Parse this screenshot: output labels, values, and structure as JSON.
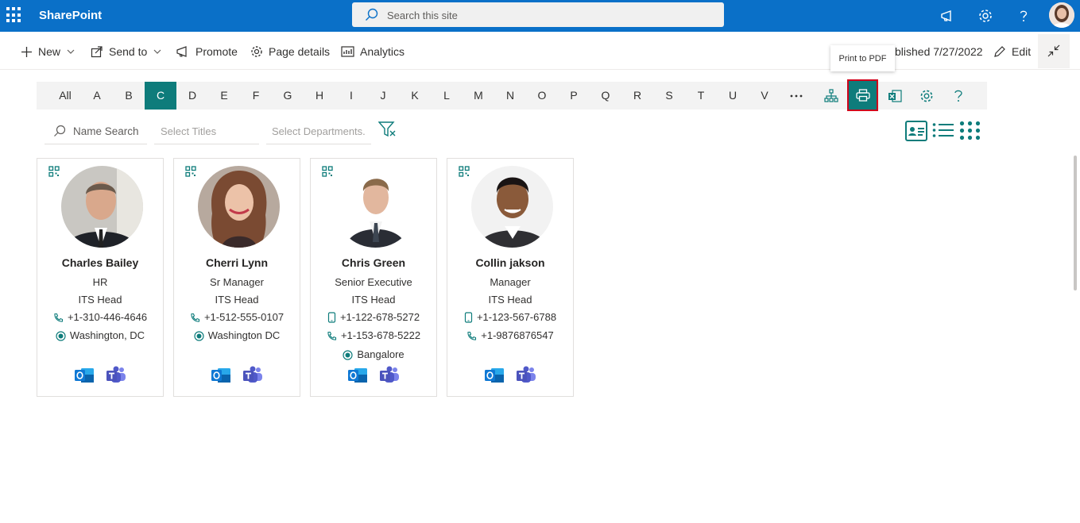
{
  "topbar": {
    "brand": "SharePoint",
    "search_placeholder": "Search this site"
  },
  "commandbar": {
    "new_label": "New",
    "send_to_label": "Send to",
    "promote_label": "Promote",
    "page_details_label": "Page details",
    "analytics_label": "Analytics",
    "published_text": "blished 7/27/2022",
    "edit_label": "Edit"
  },
  "tooltip": "Print to PDF",
  "alphabet": [
    "All",
    "A",
    "B",
    "C",
    "D",
    "E",
    "F",
    "G",
    "H",
    "I",
    "J",
    "K",
    "L",
    "M",
    "N",
    "O",
    "P",
    "Q",
    "R",
    "S",
    "T",
    "U",
    "V"
  ],
  "active_letter": "C",
  "filters": {
    "name_search": "Name Search",
    "titles": "Select Titles",
    "departments": "Select Departments."
  },
  "colors": {
    "brand_blue": "#0a70c8",
    "accent_teal": "#0e7c7b",
    "highlight_red": "#d0021b"
  },
  "cards": [
    {
      "name": "Charles Bailey",
      "line1": "HR",
      "line2": "ITS Head",
      "phone": "+1-310-446-4646",
      "location": "Washington, DC"
    },
    {
      "name": "Cherri Lynn",
      "line1": "Sr Manager",
      "line2": "ITS Head",
      "phone": "+1-512-555-0107",
      "location": "Washington DC"
    },
    {
      "name": "Chris Green",
      "line1": "Senior Executive",
      "line2": "ITS Head",
      "mobile": "+1-122-678-5272",
      "phone": "+1-153-678-5222",
      "location": "Bangalore"
    },
    {
      "name": "Collin jakson",
      "line1": "Manager",
      "line2": "ITS Head",
      "mobile": "+1-123-567-6788",
      "phone": "+1-9876876547"
    }
  ]
}
